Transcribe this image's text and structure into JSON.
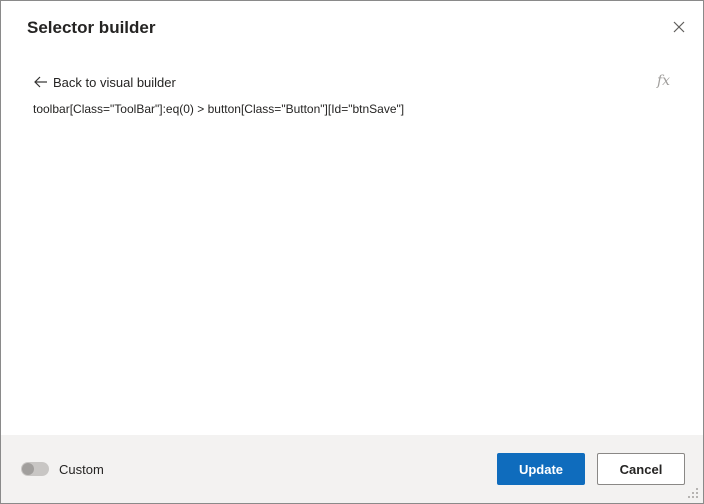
{
  "dialog": {
    "title": "Selector builder",
    "close_icon": "close-icon"
  },
  "editor": {
    "back_label": "Back to visual builder",
    "back_icon": "arrow-left-icon",
    "fx_icon": "function-icon",
    "fx_glyph": "fx",
    "selector": "toolbar[Class=\"ToolBar\"]:eq(0) > button[Class=\"Button\"][Id=\"btnSave\"]"
  },
  "footer": {
    "custom_label": "Custom",
    "custom_enabled": false,
    "update_label": "Update",
    "cancel_label": "Cancel"
  },
  "colors": {
    "primary": "#0f6cbd",
    "footer_bg": "#f3f2f1"
  }
}
